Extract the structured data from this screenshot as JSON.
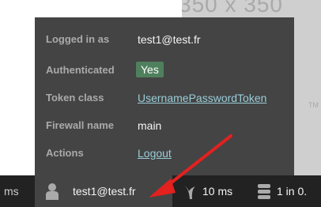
{
  "background_image": {
    "placeholder_text": "350 x 350",
    "side_text": "TM"
  },
  "panel": {
    "rows": [
      {
        "label": "Logged in as",
        "value": "test1@test.fr"
      },
      {
        "label": "Authenticated",
        "value": "Yes"
      },
      {
        "label": "Token class",
        "value": "UsernamePasswordToken"
      },
      {
        "label": "Firewall name",
        "value": "main"
      },
      {
        "label": "Actions",
        "value": "Logout"
      }
    ]
  },
  "toolbar": {
    "left_partial": "ms",
    "user_label": "test1@test.fr",
    "time_value": "10 ms",
    "db_value": "1 in 0."
  },
  "colors": {
    "panel_bg": "#444444",
    "toolbar_bg": "#222222",
    "badge_green": "#4f805d",
    "link": "#99cdd8",
    "arrow": "#e3211f"
  },
  "icons": [
    "user-icon",
    "time-icon",
    "database-icon",
    "arrow-annotation"
  ]
}
